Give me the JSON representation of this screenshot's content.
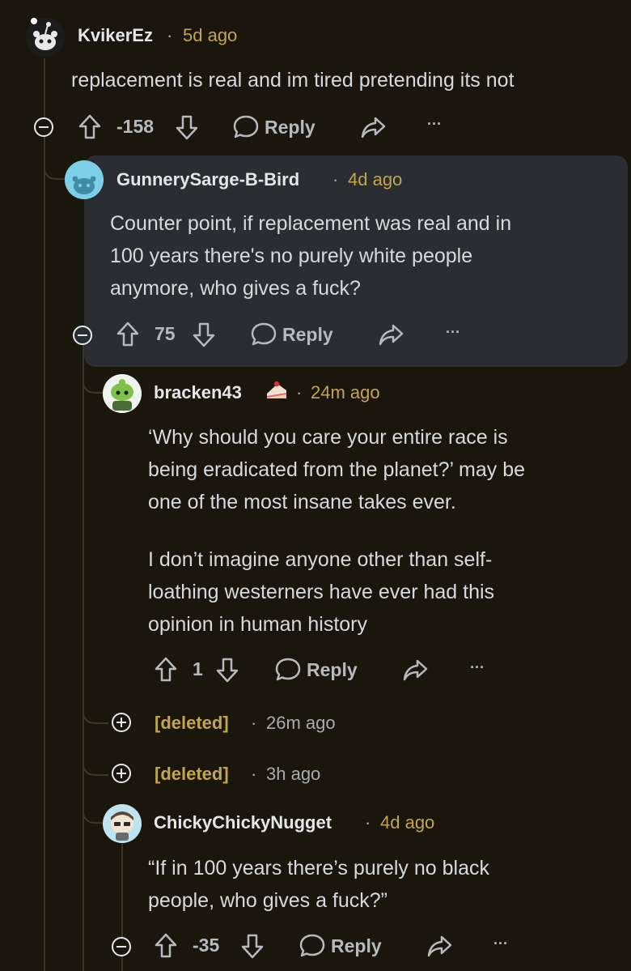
{
  "comments": [
    {
      "username": "KvikerEz",
      "time": "5d ago",
      "body": [
        "replacement is real and im tired pretending its not"
      ],
      "score": "-158",
      "reply_label": "Reply",
      "more": "···"
    },
    {
      "username": "GunnerySarge-B-Bird",
      "time": "4d ago",
      "body": [
        "Counter point, if replacement was real and in",
        "100 years there's no purely white people",
        "anymore, who gives a fuck?"
      ],
      "score": "75",
      "reply_label": "Reply",
      "more": "···"
    },
    {
      "username": "bracken43",
      "flair_icon": "cake-icon",
      "time": "24m ago",
      "body": [
        "‘Why should you care your entire race is",
        "being eradicated from the planet?’ may be",
        "one of the most insane takes ever."
      ],
      "body2": [
        "I don’t imagine anyone other than self-",
        "loathing westerners have ever had this",
        "opinion in human history"
      ],
      "score": "1",
      "reply_label": "Reply",
      "more": "···"
    },
    {
      "username": "[deleted]",
      "time": "26m ago"
    },
    {
      "username": "[deleted]",
      "time": "3h ago"
    },
    {
      "username": "ChickyChickyNugget",
      "time": "4d ago",
      "body": [
        "“If in 100 years there’s purely no black",
        "people, who gives a fuck?”"
      ],
      "score": "-35",
      "reply_label": "Reply",
      "more": "···"
    }
  ],
  "separator": "·",
  "colors": {
    "background": "#1a160c",
    "highlight": "#2a2d31",
    "meta_accent": "#c3a54e"
  }
}
